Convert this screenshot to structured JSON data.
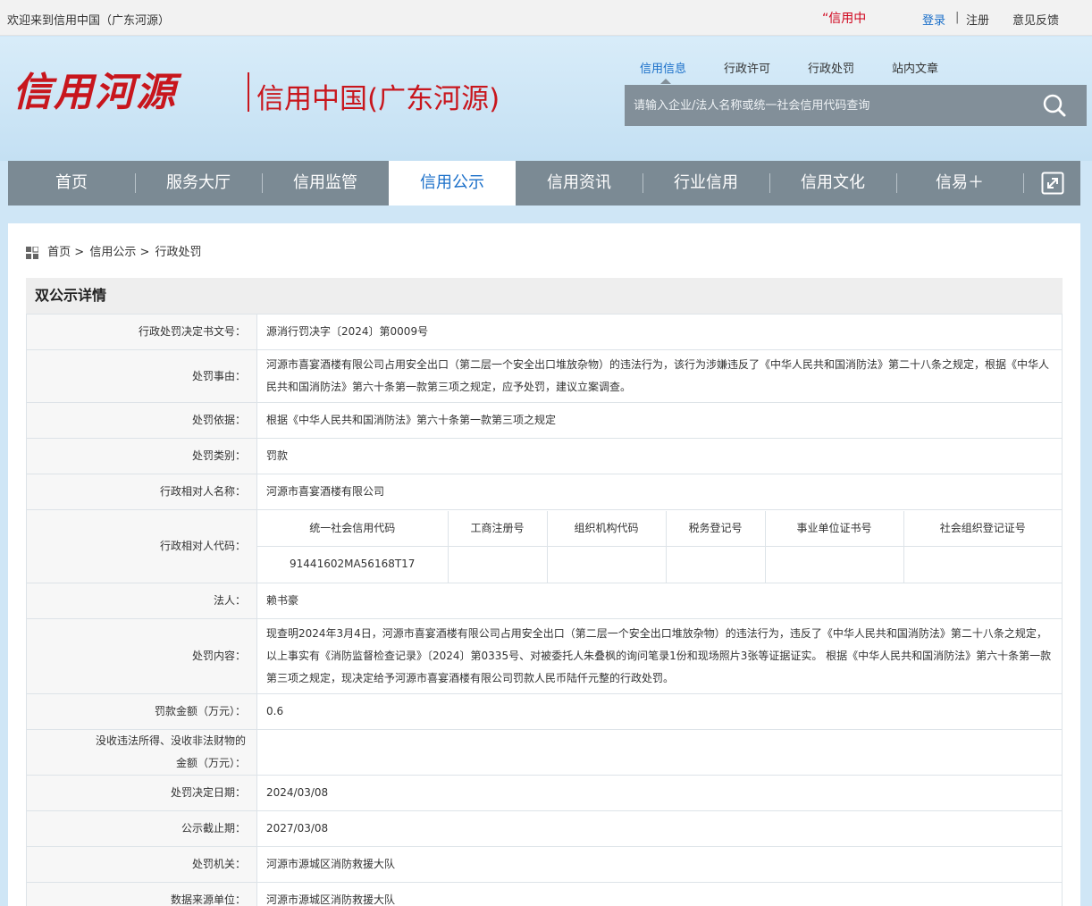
{
  "topbar": {
    "welcome": "欢迎来到信用中国（广东河源）",
    "marquee": "“信用中",
    "login": "登录",
    "separator": "|",
    "register": "注册",
    "feedback": "意见反馈"
  },
  "header": {
    "logo_calligraphy": "信用河源",
    "logo_subtitle": "信用中国(广东河源)",
    "search_tabs": [
      "信用信息",
      "行政许可",
      "行政处罚",
      "站内文章"
    ],
    "search_placeholder": "请输入企业/法人名称或统一社会信用代码查询"
  },
  "nav": {
    "items": [
      "首页",
      "服务大厅",
      "信用监管",
      "信用公示",
      "信用资讯",
      "行业信用",
      "信用文化",
      "信易＋"
    ],
    "active_index": 3
  },
  "breadcrumb": {
    "home": "首页",
    "sep": ">",
    "level1": "信用公示",
    "level2": "行政处罚"
  },
  "detail": {
    "title": "双公示详情",
    "fields": {
      "doc_no_label": "行政处罚决定书文号：",
      "doc_no": "源消行罚决字〔2024〕第0009号",
      "reason_label": "处罚事由：",
      "reason": "河源市喜宴酒楼有限公司占用安全出口（第二层一个安全出口堆放杂物）的违法行为，该行为涉嫌违反了《中华人民共和国消防法》第二十八条之规定，根据《中华人民共和国消防法》第六十条第一款第三项之规定，应予处罚，建议立案调查。",
      "basis_label": "处罚依据：",
      "basis": "根据《中华人民共和国消防法》第六十条第一款第三项之规定",
      "category_label": "处罚类别：",
      "category": "罚款",
      "party_name_label": "行政相对人名称：",
      "party_name": "河源市喜宴酒楼有限公司",
      "party_code_label": "行政相对人代码：",
      "code_headers": [
        "统一社会信用代码",
        "工商注册号",
        "组织机构代码",
        "税务登记号",
        "事业单位证书号",
        "社会组织登记证号"
      ],
      "code_values": [
        "91441602MA56168T17",
        "",
        "",
        "",
        "",
        ""
      ],
      "legal_rep_label": "法人：",
      "legal_rep": "赖书豪",
      "content_label": "处罚内容：",
      "content": "现查明2024年3月4日，河源市喜宴酒楼有限公司占用安全出口（第二层一个安全出口堆放杂物）的违法行为，违反了《中华人民共和国消防法》第二十八条之规定，以上事实有《消防监督检查记录》〔2024〕第0335号、对被委托人朱叠枫的询问笔录1份和现场照片3张等证据证实。 根据《中华人民共和国消防法》第六十条第一款第三项之规定，现决定给予河源市喜宴酒楼有限公司罚款人民币陆仟元整的行政处罚。",
      "fine_label": "罚款金额（万元）：",
      "fine": "0.6",
      "confiscate_label_1": "没收违法所得、没收非法财物的",
      "confiscate_label_2": "金额（万元）：",
      "confiscate": "",
      "decision_date_label": "处罚决定日期：",
      "decision_date": "2024/03/08",
      "expiry_label": "公示截止期：",
      "expiry": "2027/03/08",
      "authority_label": "处罚机关：",
      "authority": "河源市源城区消防救援大队",
      "source_label": "数据来源单位：",
      "source": "河源市源城区消防救援大队"
    }
  }
}
